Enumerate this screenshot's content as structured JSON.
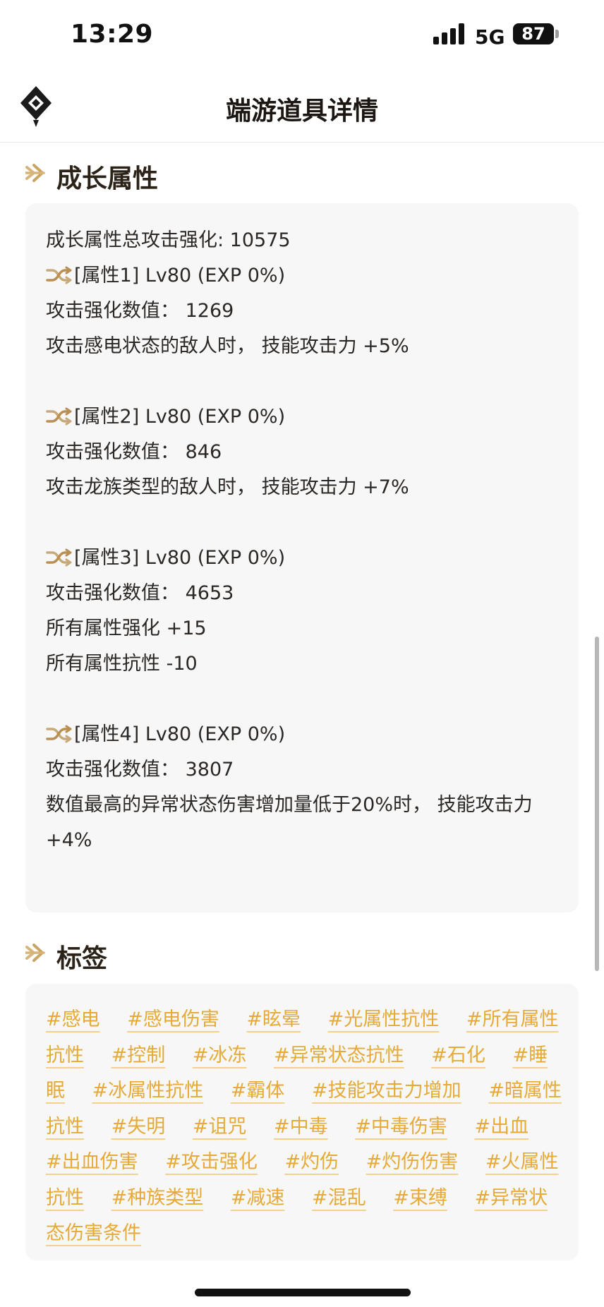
{
  "status": {
    "time": "13:29",
    "network": "5G",
    "battery": "87"
  },
  "header": {
    "title": "端游道具详情"
  },
  "growth": {
    "title": "成长属性",
    "total": "成长属性总攻击强化: 10575",
    "attributes": [
      {
        "heading": "[属性1] Lv80 (EXP 0%)",
        "lines": [
          "攻击强化数值： 1269",
          "攻击感电状态的敌人时， 技能攻击力 +5%"
        ]
      },
      {
        "heading": "[属性2] Lv80 (EXP 0%)",
        "lines": [
          "攻击强化数值： 846",
          "攻击龙族类型的敌人时， 技能攻击力 +7%"
        ]
      },
      {
        "heading": "[属性3] Lv80 (EXP 0%)",
        "lines": [
          "攻击强化数值： 4653",
          "所有属性强化 +15",
          "所有属性抗性 -10"
        ]
      },
      {
        "heading": "[属性4] Lv80 (EXP 0%)",
        "lines": [
          "攻击强化数值： 3807",
          "数值最高的异常状态伤害增加量低于20%时， 技能攻击力 +4%"
        ]
      }
    ]
  },
  "tags": {
    "title": "标签",
    "items": [
      "#感电",
      "#感电伤害",
      "#眩晕",
      "#光属性抗性",
      "#所有属性抗性",
      "#控制",
      "#冰冻",
      "#异常状态抗性",
      "#石化",
      "#睡眠",
      "#冰属性抗性",
      "#霸体",
      "#技能攻击力增加",
      "#暗属性抗性",
      "#失明",
      "#诅咒",
      "#中毒",
      "#中毒伤害",
      "#出血",
      "#出血伤害",
      "#攻击强化",
      "#灼伤",
      "#灼伤伤害",
      "#火属性抗性",
      "#种族类型",
      "#减速",
      "#混乱",
      "#束缚",
      "#异常状态伤害条件"
    ]
  },
  "colors": {
    "tag": "#e5aa37",
    "accent": "#c9a463",
    "card_bg": "#f7f7f7"
  },
  "icons": {
    "logo": "diamond-logo-icon",
    "section": "double-chevron-right-icon",
    "attribute": "shuffle-icon"
  }
}
